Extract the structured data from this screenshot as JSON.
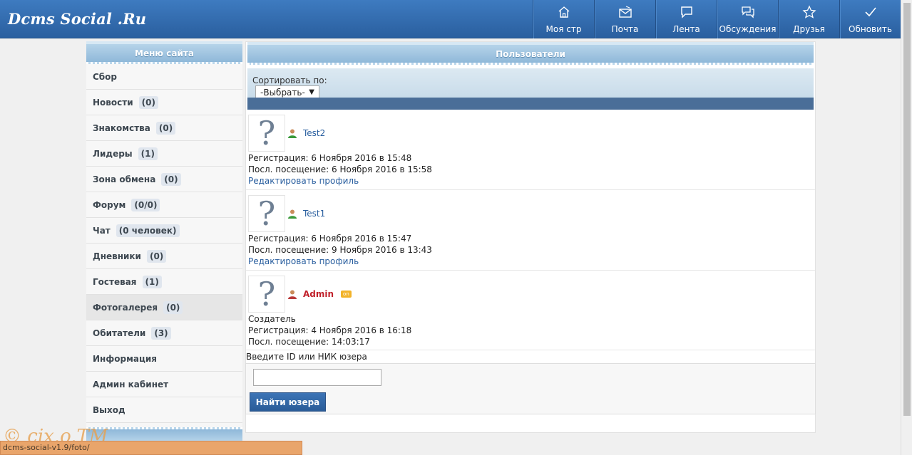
{
  "header": {
    "logo": "Dcms Social .Ru",
    "nav": [
      {
        "label": "Моя стр",
        "icon": "home-icon"
      },
      {
        "label": "Почта",
        "icon": "mail-icon"
      },
      {
        "label": "Лента",
        "icon": "feed-icon"
      },
      {
        "label": "Обсуждения",
        "icon": "discussion-icon"
      },
      {
        "label": "Друзья",
        "icon": "star-icon"
      },
      {
        "label": "Обновить",
        "icon": "check-icon"
      }
    ]
  },
  "sidebar": {
    "title": "Меню сайта",
    "items": [
      {
        "label": "Сбор",
        "count": ""
      },
      {
        "label": "Новости",
        "count": "(0)"
      },
      {
        "label": "Знакомства",
        "count": "(0)"
      },
      {
        "label": "Лидеры",
        "count": "(1)"
      },
      {
        "label": "Зона обмена",
        "count": "(0)"
      },
      {
        "label": "Форум",
        "count": "(0/0)"
      },
      {
        "label": "Чат",
        "count": "(0 человек)"
      },
      {
        "label": "Дневники",
        "count": "(0)"
      },
      {
        "label": "Гостевая",
        "count": "(1)"
      },
      {
        "label": "Фотогалерея",
        "count": "(0)"
      },
      {
        "label": "Обитатели",
        "count": "(3)"
      },
      {
        "label": "Информация",
        "count": ""
      },
      {
        "label": "Админ кабинет",
        "count": ""
      },
      {
        "label": "Выход",
        "count": ""
      }
    ]
  },
  "main": {
    "title": "Пользователи",
    "sort_label": "Сортировать по:",
    "sort_value": "-Выбрать-",
    "users": [
      {
        "name": "Test2",
        "role": "",
        "registered": "Регистрация: 6 Ноября 2016 в 15:48",
        "last_visit": "Посл. посещение: 6 Ноября 2016 в 15:58",
        "edit": "Редактировать профиль",
        "online": ""
      },
      {
        "name": "Test1",
        "role": "",
        "registered": "Регистрация: 6 Ноября 2016 в 15:47",
        "last_visit": "Посл. посещение: 9 Ноября 2016 в 13:43",
        "edit": "Редактировать профиль",
        "online": ""
      },
      {
        "name": "Admin",
        "role": "Создатель",
        "registered": "Регистрация: 4 Ноября 2016 в 16:18",
        "last_visit": "Посл. посещение: 14:03:17",
        "edit": "",
        "online": "on"
      }
    ],
    "search_label": "Введите ID или НИК юзера",
    "search_button": "Найти юзера"
  },
  "statusbar": {
    "text": "dcms-social-v1.9/foto/"
  },
  "colors": {
    "header": "#2a5f9f",
    "link": "#2a5f9f",
    "admin": "#c0202a",
    "online": "#f2b32a"
  }
}
